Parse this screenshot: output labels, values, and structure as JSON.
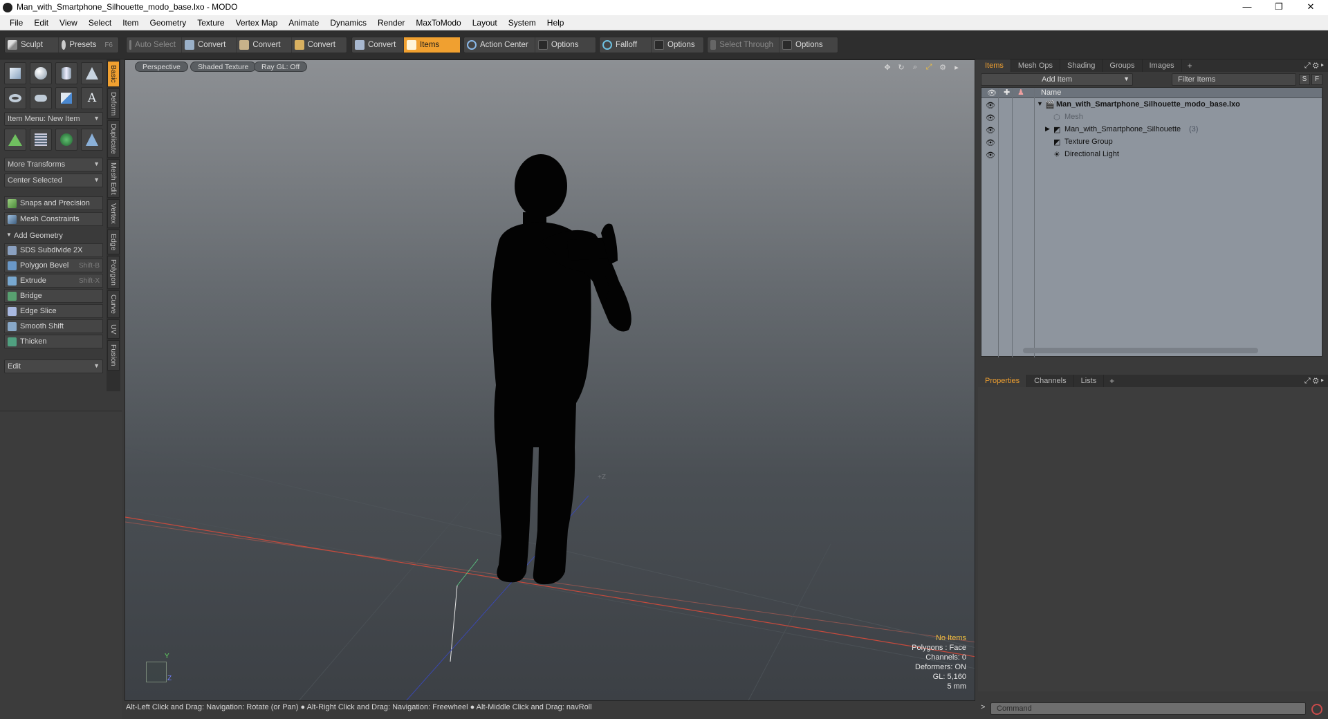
{
  "window": {
    "title": "Man_with_Smartphone_Silhouette_modo_base.lxo - MODO",
    "controls": {
      "minimize": "—",
      "restore": "❐",
      "close": "✕"
    }
  },
  "menu": [
    "File",
    "Edit",
    "View",
    "Select",
    "Item",
    "Geometry",
    "Texture",
    "Vertex Map",
    "Animate",
    "Dynamics",
    "Render",
    "MaxToModo",
    "Layout",
    "System",
    "Help"
  ],
  "toolbar": {
    "sculpt": "Sculpt",
    "presets": "Presets",
    "presets_key": "F6",
    "auto_select": "Auto Select",
    "convert1": "Convert",
    "convert2": "Convert",
    "convert3": "Convert",
    "convert4": "Convert",
    "items": "Items",
    "action_center": "Action Center",
    "options1": "Options",
    "falloff": "Falloff",
    "options2": "Options",
    "select_through": "Select Through",
    "options3": "Options"
  },
  "left_panel": {
    "item_menu": "Item Menu: New Item",
    "more_transforms": "More Transforms",
    "center_selected": "Center Selected",
    "snaps": "Snaps and Precision",
    "mesh_constraints": "Mesh Constraints",
    "add_geometry": "Add Geometry",
    "tools": [
      {
        "label": "SDS Subdivide 2X",
        "key": ""
      },
      {
        "label": "Polygon Bevel",
        "key": "Shift-B"
      },
      {
        "label": "Extrude",
        "key": "Shift-X"
      },
      {
        "label": "Bridge",
        "key": ""
      },
      {
        "label": "Edge Slice",
        "key": ""
      },
      {
        "label": "Smooth Shift",
        "key": ""
      },
      {
        "label": "Thicken",
        "key": ""
      }
    ],
    "edit": "Edit"
  },
  "vertical_tabs": [
    "Basic",
    "Deform",
    "Duplicate",
    "Mesh Edit",
    "Vertex",
    "Edge",
    "Polygon",
    "Curve",
    "UV",
    "Fusion"
  ],
  "viewport": {
    "view": "Perspective",
    "shading": "Shaded Texture",
    "raygl": "Ray GL: Off",
    "axis_label": "+Z",
    "gizmo_y": "Y",
    "gizmo_z": "Z",
    "info": {
      "no_items": "No Items",
      "polygons": "Polygons : Face",
      "channels": "Channels: 0",
      "deformers": "Deformers: ON",
      "gl": "GL: 5,160",
      "units": "5 mm"
    }
  },
  "status": "Alt-Left Click and Drag: Navigation: Rotate (or Pan) ● Alt-Right Click and Drag: Navigation: Freewheel ● Alt-Middle Click and Drag: navRoll",
  "items_panel": {
    "tabs": [
      "Items",
      "Mesh Ops",
      "Shading",
      "Groups",
      "Images"
    ],
    "add_item": "Add Item",
    "filter": "Filter Items",
    "btn_s": "S",
    "btn_f": "F",
    "col_name": "Name",
    "rows": [
      {
        "label": "Man_with_Smartphone_Silhouette_modo_base.lxo",
        "count": ""
      },
      {
        "label": "Mesh",
        "count": ""
      },
      {
        "label": "Man_with_Smartphone_Silhouette",
        "count": "(3)"
      },
      {
        "label": "Texture Group",
        "count": ""
      },
      {
        "label": "Directional Light",
        "count": ""
      }
    ]
  },
  "props_panel": {
    "tabs": [
      "Properties",
      "Channels",
      "Lists"
    ]
  },
  "command": {
    "placeholder": "Command"
  },
  "colors": {
    "accent": "#f0a030",
    "panel": "#3a3a3a",
    "tree_bg": "#8e959e"
  }
}
